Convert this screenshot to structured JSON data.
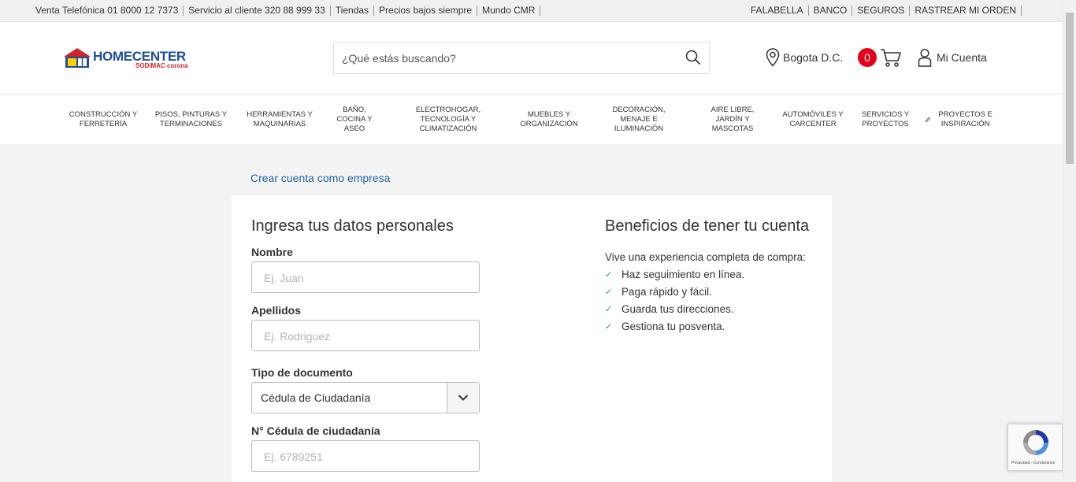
{
  "topbar": {
    "left": [
      {
        "label": "Venta Telefónica",
        "value": "01 8000 12 7373"
      },
      {
        "label": "Servicio al cliente",
        "value": "320 88 999 33"
      },
      {
        "label": "Tiendas",
        "value": ""
      },
      {
        "label": "Precios bajos siempre",
        "value": ""
      },
      {
        "label": "Mundo CMR",
        "value": ""
      }
    ],
    "right": [
      "FALABELLA",
      "BANCO",
      "SEGUROS",
      "RASTREAR MI ORDEN"
    ]
  },
  "header": {
    "logo_brand": "HOMECENTER",
    "logo_sub": "SODIMAC corona",
    "search_placeholder": "¿Qué estás buscando?",
    "location": "Bogota D.C.",
    "cart_count": "0",
    "account": "Mi Cuenta"
  },
  "categories": [
    "CONSTRUCCIÓN Y FERRETERÍA",
    "PISOS, PINTURAS Y TERMINACIONES",
    "HERRAMIENTAS Y MAQUINARIAS",
    "BAÑO, COCINA Y ASEO",
    "ELECTROHOGAR, TECNOLOGÍA Y CLIMATIZACIÓN",
    "MUEBLES Y ORGANIZACIÓN",
    "DECORACIÓN, MENAJE E ILUMINACIÓN",
    "AIRE LIBRE, JARDÍN Y MASCOTAS",
    "AUTOMÓVILES Y CARCENTER",
    "SERVICIOS Y PROYECTOS",
    "PROYECTOS E INSPIRACIÓN"
  ],
  "main": {
    "company_link": "Crear cuenta como empresa",
    "form_title": "Ingresa tus datos personales",
    "fields": {
      "nombre_label": "Nombre",
      "nombre_placeholder": "Ej. Juan",
      "apellidos_label": "Apellidos",
      "apellidos_placeholder": "Ej. Rodriguez",
      "tipo_doc_label": "Tipo de documento",
      "tipo_doc_value": "Cédula de Ciudadanía",
      "cedula_label": "N° Cédula de ciudadanía",
      "cedula_placeholder": "Ej. 6789251"
    },
    "benefits_title": "Beneficios de tener tu cuenta",
    "benefits_intro": "Vive una experiencia completa de compra:",
    "benefits": [
      "Haz seguimiento en línea.",
      "Paga rápido y fácil.",
      "Guarda tus direcciones.",
      "Gestiona tu posventa."
    ]
  },
  "recaptcha": {
    "text": "Privacidad - Condiciones"
  }
}
